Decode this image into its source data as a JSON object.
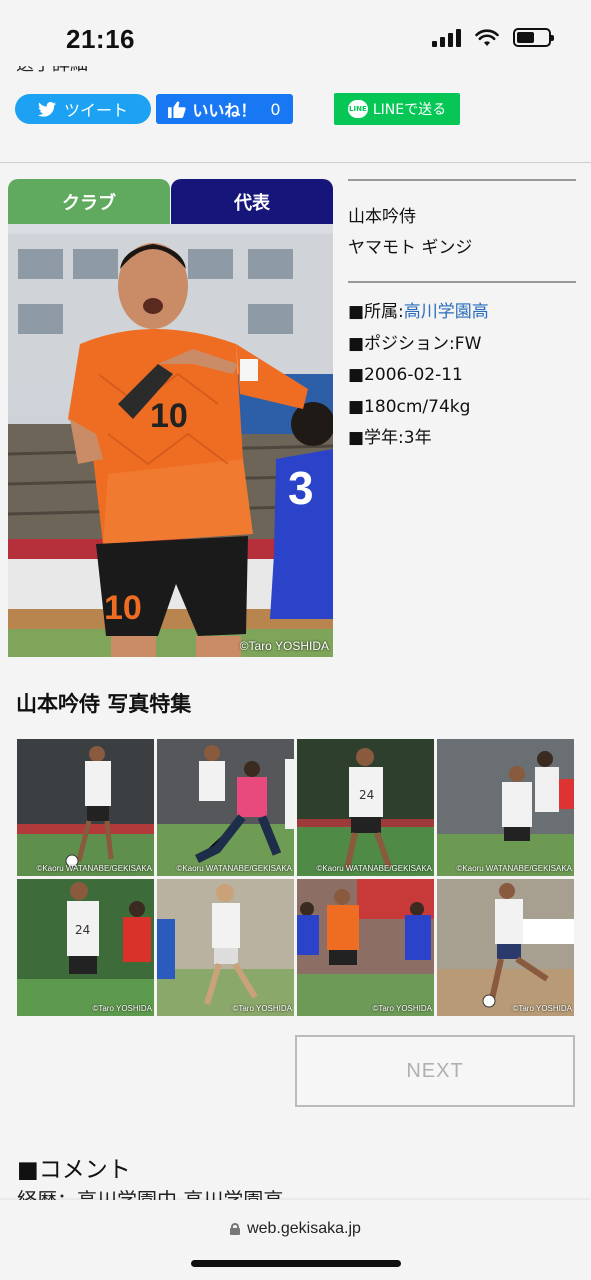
{
  "status": {
    "time": "21:16"
  },
  "header": {
    "cut_title": "選手詳細"
  },
  "share": {
    "tweet_label": "ツイート",
    "like_label": "いいね！",
    "like_count": "0",
    "line_label": "LINEで送る",
    "line_badge": "LINE"
  },
  "tabs": {
    "club": "クラブ",
    "national": "代表"
  },
  "photo": {
    "credit": "©Taro YOSHIDA",
    "jersey_number": "10",
    "opponent_number": "3"
  },
  "player": {
    "name": "山本吟侍",
    "kana": "ヤマモト ギンジ",
    "affiliation_prefix": "■所属:",
    "affiliation_link": "高川学園高",
    "position": "■ポジション:FW",
    "birthdate": "■2006-02-11",
    "size": "■180cm/74kg",
    "grade": "■学年:3年"
  },
  "gallery": {
    "title": "山本吟侍 写真特集",
    "items": [
      {
        "credit": "©Kaoru WATANABE/GEKISAKA"
      },
      {
        "credit": "©Kaoru WATANABE/GEKISAKA"
      },
      {
        "credit": "©Kaoru WATANABE/GEKISAKA"
      },
      {
        "credit": "©Kaoru WATANABE/GEKISAKA"
      },
      {
        "credit": "©Taro YOSHIDA"
      },
      {
        "credit": "©Taro YOSHIDA"
      },
      {
        "credit": "©Taro YOSHIDA"
      },
      {
        "credit": "©Taro YOSHIDA"
      }
    ]
  },
  "pagination": {
    "next_label": "NEXT"
  },
  "comment": {
    "title": "■コメント",
    "text": "経歴：高川学園中 高川学園高"
  },
  "browser": {
    "url": "web.gekisaka.jp"
  }
}
